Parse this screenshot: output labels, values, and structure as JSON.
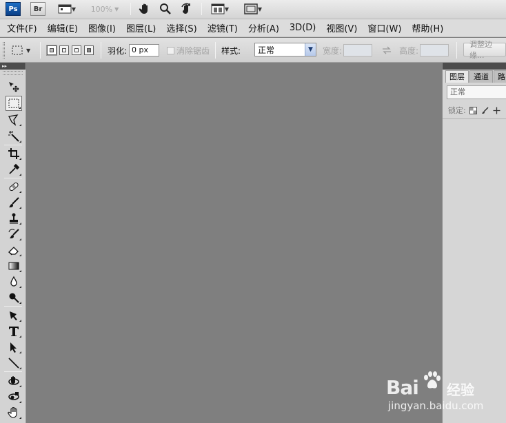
{
  "appbar": {
    "ps_logo": "Ps",
    "br_logo": "Br",
    "zoom": "100%",
    "icons": [
      "ps-logo-icon",
      "bridge-logo-icon",
      "view-extras-icon",
      "hand-icon",
      "zoom-icon",
      "rotate-view-icon",
      "arrange-documents-icon",
      "screen-mode-icon"
    ]
  },
  "menu": {
    "items": [
      "文件(F)",
      "编辑(E)",
      "图像(I)",
      "图层(L)",
      "选择(S)",
      "滤镜(T)",
      "分析(A)",
      "3D(D)",
      "视图(V)",
      "窗口(W)",
      "帮助(H)"
    ]
  },
  "options": {
    "feather_label": "羽化:",
    "feather_value": "0 px",
    "antialias_label": "消除锯齿",
    "style_label": "样式:",
    "style_value": "正常",
    "width_label": "宽度:",
    "height_label": "高度:",
    "refine_edge_label": "调整边缘..."
  },
  "tools": [
    "move-tool-icon",
    "rect-marquee-tool-icon",
    "lasso-tool-icon",
    "magic-wand-tool-icon",
    "crop-tool-icon",
    "eyedropper-tool-icon",
    "healing-brush-tool-icon",
    "brush-tool-icon",
    "clone-stamp-tool-icon",
    "history-brush-tool-icon",
    "eraser-tool-icon",
    "gradient-tool-icon",
    "blur-tool-icon",
    "dodge-tool-icon",
    "pen-tool-icon",
    "type-tool-icon",
    "path-selection-tool-icon",
    "line-tool-icon",
    "3d-rotate-tool-icon",
    "3d-orbit-tool-icon",
    "hand-tool-icon"
  ],
  "panel": {
    "tabs": [
      "图层",
      "通道",
      "路"
    ],
    "blend_mode": "正常",
    "lock_label": "锁定:"
  },
  "watermark": {
    "brand": "Bai",
    "brand_cn": "经验",
    "url": "jingyan.baidu.com"
  },
  "colors": {
    "canvas": "#7f7f7f",
    "chrome": "#dcdcdc",
    "ps_blue": "#1c6fc6"
  }
}
